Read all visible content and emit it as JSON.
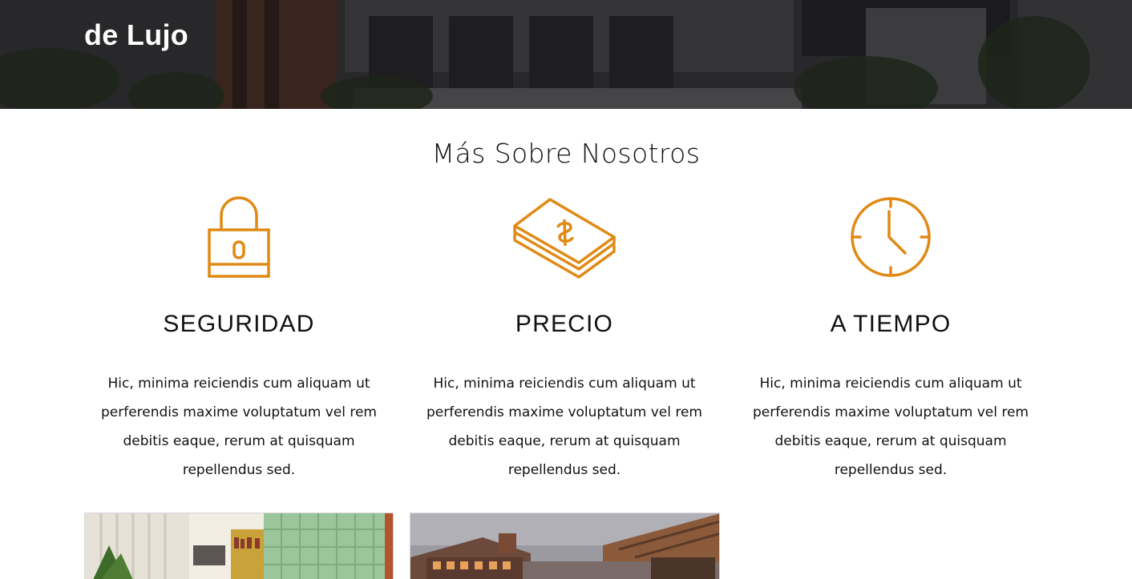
{
  "hero": {
    "title": "de Lujo"
  },
  "about": {
    "title": "Más Sobre Nosotros",
    "features": [
      {
        "icon": "padlock-icon",
        "title": "SEGURIDAD",
        "text": "Hic, minima reiciendis cum aliquam ut perferendis maxime voluptatum vel rem debitis eaque, rerum at quisquam repellendus sed."
      },
      {
        "icon": "money-stack-icon",
        "title": "PRECIO",
        "text": "Hic, minima reiciendis cum aliquam ut perferendis maxime voluptatum vel rem debitis eaque, rerum at quisquam repellendus sed."
      },
      {
        "icon": "clock-icon",
        "title": "A TIEMPO",
        "text": "Hic, minima reiciendis cum aliquam ut perferendis maxime voluptatum vel rem debitis eaque, rerum at quisquam repellendus sed."
      }
    ]
  },
  "colors": {
    "accent": "#e08a14",
    "heading": "#111111"
  },
  "gallery": [
    {
      "subject": "interior-room-photo"
    },
    {
      "subject": "house-exterior-photo"
    }
  ]
}
